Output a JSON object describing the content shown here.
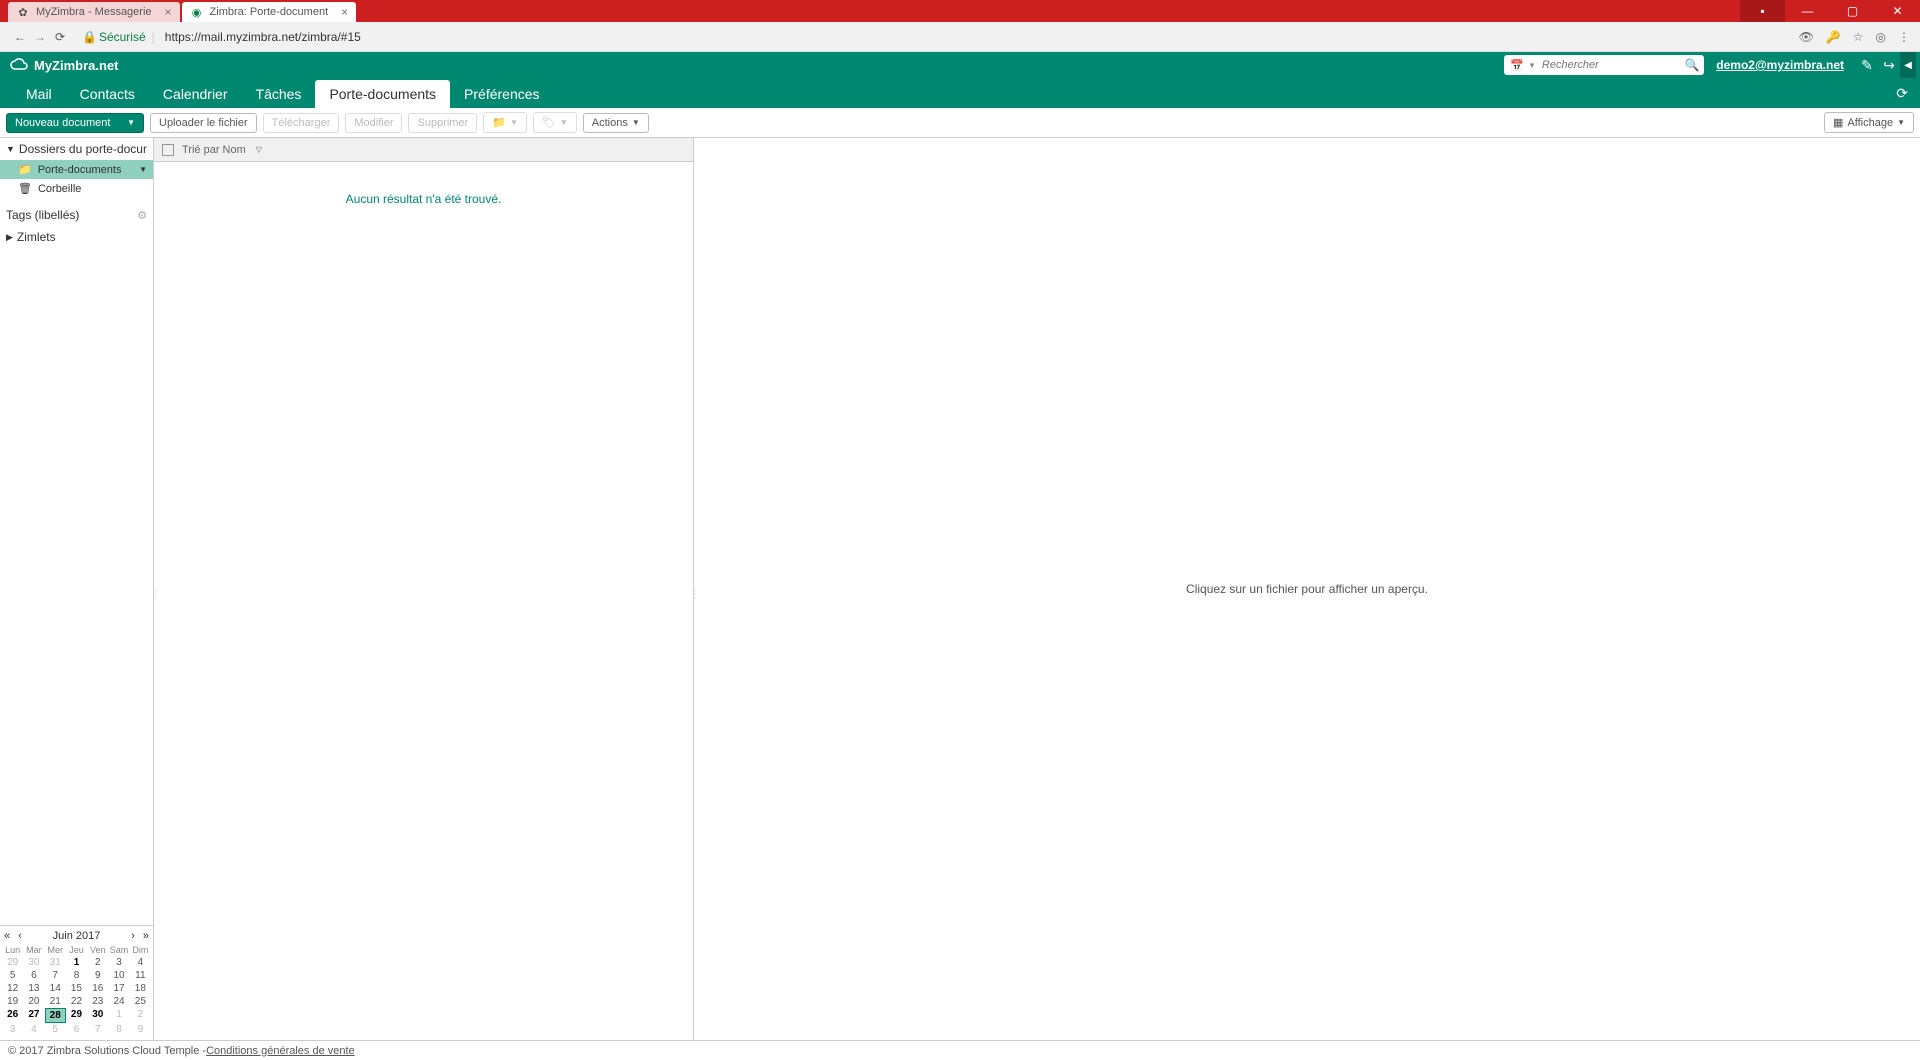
{
  "browser": {
    "tabs": [
      {
        "title": "MyZimbra - Messagerie"
      },
      {
        "title": "Zimbra: Porte-document"
      }
    ],
    "secure_label": "Sécurisé",
    "url": "https://mail.myzimbra.net/zimbra/#15"
  },
  "header": {
    "brand": "MyZimbra.net",
    "search_placeholder": "Rechercher",
    "user_email": "demo2@myzimbra.net"
  },
  "nav": {
    "mail": "Mail",
    "contacts": "Contacts",
    "calendrier": "Calendrier",
    "taches": "Tâches",
    "porte": "Porte-documents",
    "prefs": "Préférences"
  },
  "toolbar": {
    "new_doc": "Nouveau document",
    "upload": "Uploader le fichier",
    "download": "Télécharger",
    "modify": "Modifier",
    "delete": "Supprimer",
    "actions": "Actions",
    "view": "Affichage"
  },
  "sidebar": {
    "folders_hdr": "Dossiers du porte-docum",
    "porte": "Porte-documents",
    "trash": "Corbeille",
    "tags_hdr": "Tags (libellés)",
    "zimlets_hdr": "Zimlets"
  },
  "list": {
    "sorted_by": "Trié par Nom",
    "no_results": "Aucun résultat n'a été trouvé."
  },
  "preview": {
    "empty": "Cliquez sur un fichier pour afficher un aperçu."
  },
  "calendar": {
    "title": "Juin 2017",
    "dow": [
      "Lun",
      "Mar",
      "Mer",
      "Jeu",
      "Ven",
      "Sam",
      "Dim"
    ],
    "weeks": [
      [
        {
          "d": "29",
          "dim": true
        },
        {
          "d": "30",
          "dim": true
        },
        {
          "d": "31",
          "dim": true
        },
        {
          "d": "1",
          "bold": true
        },
        {
          "d": "2"
        },
        {
          "d": "3"
        },
        {
          "d": "4"
        }
      ],
      [
        {
          "d": "5"
        },
        {
          "d": "6"
        },
        {
          "d": "7"
        },
        {
          "d": "8"
        },
        {
          "d": "9"
        },
        {
          "d": "10"
        },
        {
          "d": "11"
        }
      ],
      [
        {
          "d": "12"
        },
        {
          "d": "13"
        },
        {
          "d": "14"
        },
        {
          "d": "15"
        },
        {
          "d": "16"
        },
        {
          "d": "17"
        },
        {
          "d": "18"
        }
      ],
      [
        {
          "d": "19"
        },
        {
          "d": "20"
        },
        {
          "d": "21"
        },
        {
          "d": "22"
        },
        {
          "d": "23"
        },
        {
          "d": "24"
        },
        {
          "d": "25"
        }
      ],
      [
        {
          "d": "26",
          "bold": true
        },
        {
          "d": "27",
          "bold": true
        },
        {
          "d": "28",
          "today": true,
          "bold": true
        },
        {
          "d": "29",
          "bold": true
        },
        {
          "d": "30",
          "bold": true
        },
        {
          "d": "1",
          "dim": true
        },
        {
          "d": "2",
          "dim": true
        }
      ],
      [
        {
          "d": "3",
          "dim": true
        },
        {
          "d": "4",
          "dim": true
        },
        {
          "d": "5",
          "dim": true
        },
        {
          "d": "6",
          "dim": true
        },
        {
          "d": "7",
          "dim": true
        },
        {
          "d": "8",
          "dim": true
        },
        {
          "d": "9",
          "dim": true
        }
      ]
    ]
  },
  "footer": {
    "copyright": "© 2017 Zimbra Solutions Cloud Temple - ",
    "terms": "Conditions générales de vente"
  }
}
